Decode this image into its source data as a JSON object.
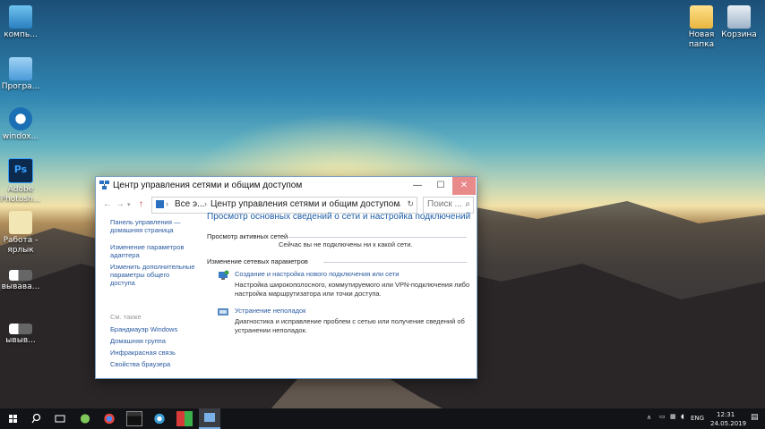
{
  "desktop": {
    "icons_left": [
      {
        "label": "компь..."
      },
      {
        "label": "Програ..."
      },
      {
        "label": "windox..."
      },
      {
        "label": "Adobe Photosh..."
      },
      {
        "label": "Работа - ярлык"
      },
      {
        "label": "вывава..."
      },
      {
        "label": "ывыв..."
      }
    ],
    "icons_right": [
      {
        "label": "Новая папка"
      },
      {
        "label": "Корзина"
      }
    ]
  },
  "window": {
    "title": "Центр управления сетями и общим доступом",
    "controls": {
      "minimize": "—",
      "maximize": "☐",
      "close": "✕"
    },
    "address": {
      "segment1": "Все э...",
      "segment2": "Центр управления сетями и общим доступом"
    },
    "search_placeholder": "Поиск ...",
    "left_pane": {
      "links": [
        "Панель управления — домашняя страница",
        "Изменение параметров адаптера",
        "Изменить дополнительные параметры общего доступа"
      ],
      "see_also_header": "См. также",
      "see_also": [
        "Брандмауэр Windows",
        "Домашняя группа",
        "Инфракрасная связь",
        "Свойства браузера"
      ]
    },
    "main": {
      "heading": "Просмотр основных сведений о сети и настройка подключений",
      "active_networks_header": "Просмотр активных сетей",
      "no_networks_text": "Сейчас вы не подключены ни к какой сети.",
      "change_settings_header": "Изменение сетевых параметров",
      "options": [
        {
          "title": "Создание и настройка нового подключения или сети",
          "desc": "Настройка широкополосного, коммутируемого или VPN-подключения либо настройка маршрутизатора или точки доступа."
        },
        {
          "title": "Устранение неполадок",
          "desc": "Диагностика и исправление проблем с сетью или получение сведений об устранении неполадок."
        }
      ]
    }
  },
  "taskbar": {
    "language": "ENG",
    "time": "12:31",
    "date": "24.05.2019"
  },
  "colors": {
    "link": "#2a5aa0",
    "heading": "#1f5ea8",
    "taskbar": "#121316",
    "close_hover": "#e98a8a"
  }
}
